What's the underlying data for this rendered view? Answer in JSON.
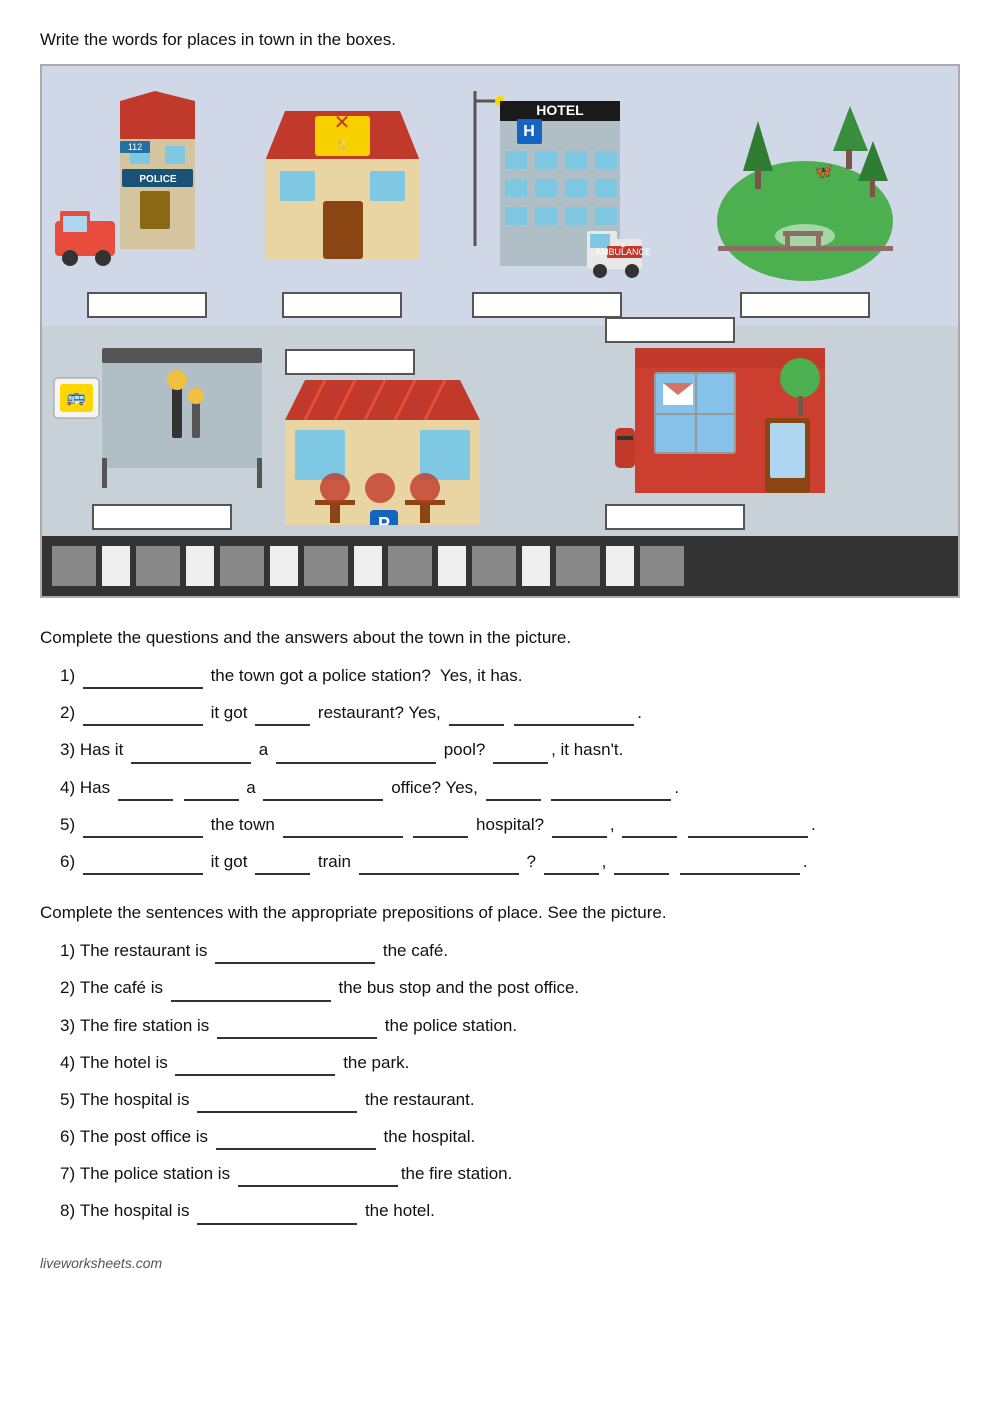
{
  "page": {
    "instruction1": "Write the words for places in town in the boxes.",
    "instruction2": "Complete the questions and the answers about the town in the picture.",
    "instruction3": "Complete the sentences with the appropriate prepositions of place. See the picture.",
    "questions": [
      "1)  _________ the town got a police station?  Yes, it has.",
      "2)  _________ it got ____ restaurant? Yes, ____ _________.",
      "3)  Has it _________ a _______________ pool? _____, it hasn't.",
      "4)  Has ______ ________ a _________ office? Yes, ____ _________.",
      "5)  _________ the town ________ _____ hospital? _____, ____ _________.",
      "6)  _________ it got _____ train ___________ ? _____, ____ _________."
    ],
    "sentences": [
      "1)  The restaurant is _______________ the café.",
      "2)  The café is _______________ the bus stop and the post office.",
      "3)  The fire station is _______________ the police station.",
      "4)  The hotel is _______________ the park.",
      "5)  The hospital is _______________ the restaurant.",
      "6)  The post office is _______________ the hospital.",
      "7)  The police station is _______________the fire station.",
      "8)  The hospital is _______________ the hotel."
    ],
    "footer": "liveworksheets.com"
  }
}
